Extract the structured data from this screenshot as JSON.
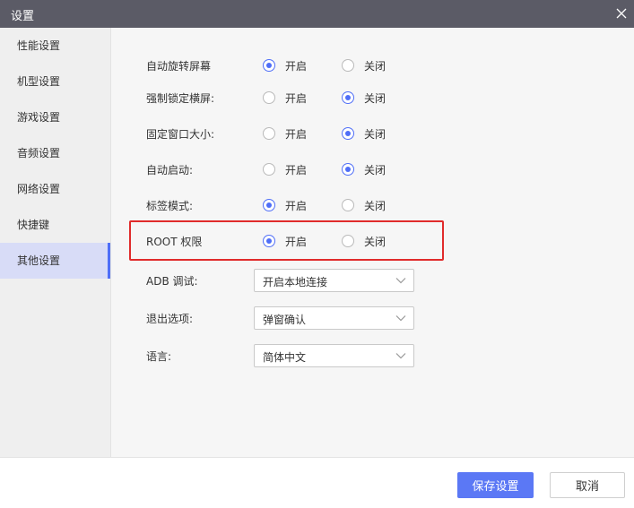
{
  "window": {
    "title": "设置"
  },
  "sidebar": {
    "items": [
      {
        "label": "性能设置"
      },
      {
        "label": "机型设置"
      },
      {
        "label": "游戏设置"
      },
      {
        "label": "音频设置"
      },
      {
        "label": "网络设置"
      },
      {
        "label": "快捷键"
      },
      {
        "label": "其他设置",
        "active": true
      }
    ]
  },
  "settings": {
    "radio_rows": [
      {
        "label": "自动旋转屏幕",
        "on_label": "开启",
        "off_label": "关闭",
        "selected": "on"
      },
      {
        "label": "强制锁定横屏:",
        "on_label": "开启",
        "off_label": "关闭",
        "selected": "off"
      },
      {
        "label": "固定窗口大小:",
        "on_label": "开启",
        "off_label": "关闭",
        "selected": "off"
      },
      {
        "label": "自动启动:",
        "on_label": "开启",
        "off_label": "关闭",
        "selected": "off"
      },
      {
        "label": "标签模式:",
        "on_label": "开启",
        "off_label": "关闭",
        "selected": "on"
      },
      {
        "label": "ROOT 权限",
        "on_label": "开启",
        "off_label": "关闭",
        "selected": "on"
      }
    ],
    "selects": [
      {
        "label": "ADB 调试:",
        "value": "开启本地连接"
      },
      {
        "label": "退出选项:",
        "value": "弹窗确认"
      },
      {
        "label": "语言:",
        "value": "简体中文"
      }
    ]
  },
  "footer": {
    "save_label": "保存设置",
    "cancel_label": "取消"
  },
  "colors": {
    "accent": "#4f6ef7",
    "titlebar": "#5b5b66",
    "highlight": "#e02b2b"
  }
}
